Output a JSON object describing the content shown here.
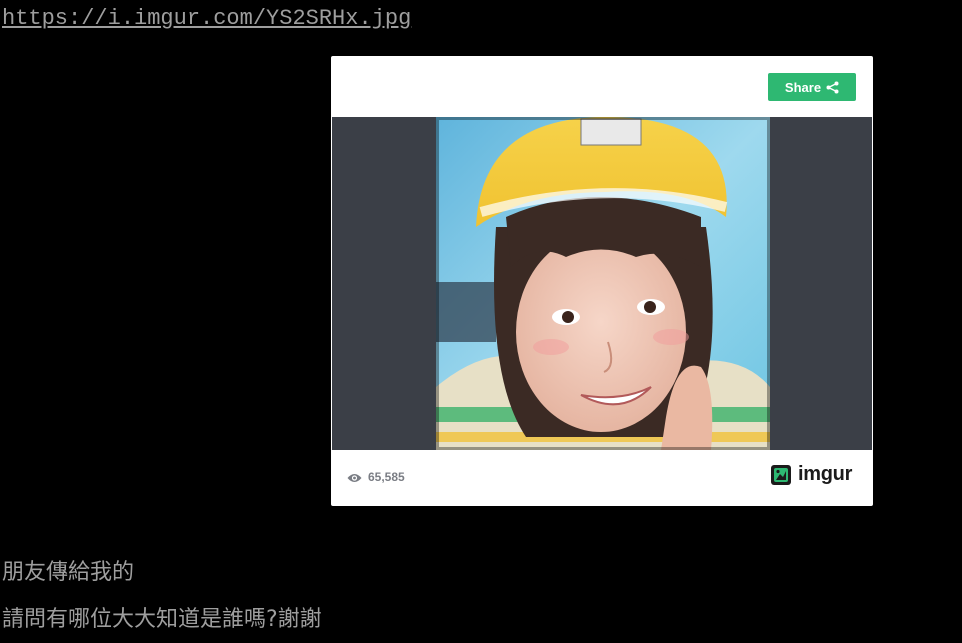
{
  "post": {
    "link_text": "https://i.imgur.com/YS2SRHx.jpg",
    "paragraphs": [
      "朋友傳給我的",
      "請問有哪位大大知道是誰嗎?謝謝"
    ]
  },
  "embed": {
    "share_label": "Share",
    "share_icon": "share-icon",
    "view_count": "65,585",
    "view_icon": "eye-icon",
    "brand": "imgur",
    "brand_icon": "imgur-logo-mark",
    "image_alt": "selfie-photo",
    "colors": {
      "share_button": "#2eb872",
      "stage_background": "#3b3f47",
      "footer_text": "#7a7d84"
    }
  }
}
